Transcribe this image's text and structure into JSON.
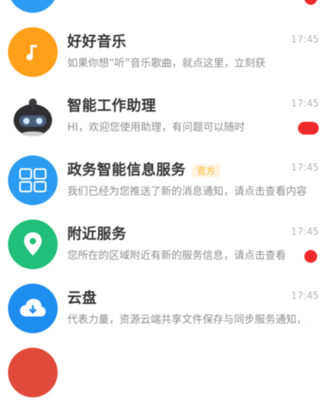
{
  "conversations": [
    {
      "id_name": "top-partial",
      "title": "",
      "preview": "",
      "time": "",
      "icon": "app-icon",
      "color": "#2d9bf0",
      "badge": "dot"
    },
    {
      "id_name": "music",
      "title": "好好音乐",
      "preview": "如果你想“听”音乐歌曲，就点这里，立刻获",
      "time": "17:45",
      "icon": "music-note-icon",
      "color": "#ff9f1a",
      "badge": ""
    },
    {
      "id_name": "robot-assistant",
      "title": "智能工作助理",
      "preview": "HI，欢迎您使用助理，有问题可以随时",
      "time": "17:45",
      "icon": "robot-icon",
      "color": "#3a3a3a",
      "badge": "pill"
    },
    {
      "id_name": "info-service",
      "title": "政务智能信息服务",
      "tag": "官方",
      "preview": "我们已经为您推送了新的消息通知，请点击查看内容",
      "time": "17:45",
      "icon": "info-icon",
      "color": "#2d9bf0",
      "badge": ""
    },
    {
      "id_name": "location",
      "title": "附近服务",
      "preview": "您所在的区域附近有新的服务信息，请点击查看",
      "time": "17:45",
      "icon": "location-pin-icon",
      "color": "#22bf7a",
      "badge": "dot"
    },
    {
      "id_name": "cloud",
      "title": "云盘",
      "preview": "代表力量，资源云端共享文件保存与同步服务通知，立即查看",
      "time": "17:45",
      "icon": "cloud-icon",
      "color": "#1f8df0",
      "badge": ""
    },
    {
      "id_name": "bottom-partial",
      "title": "",
      "preview": "",
      "time": "",
      "icon": "app-icon",
      "color": "#e04a3a",
      "badge": ""
    }
  ]
}
